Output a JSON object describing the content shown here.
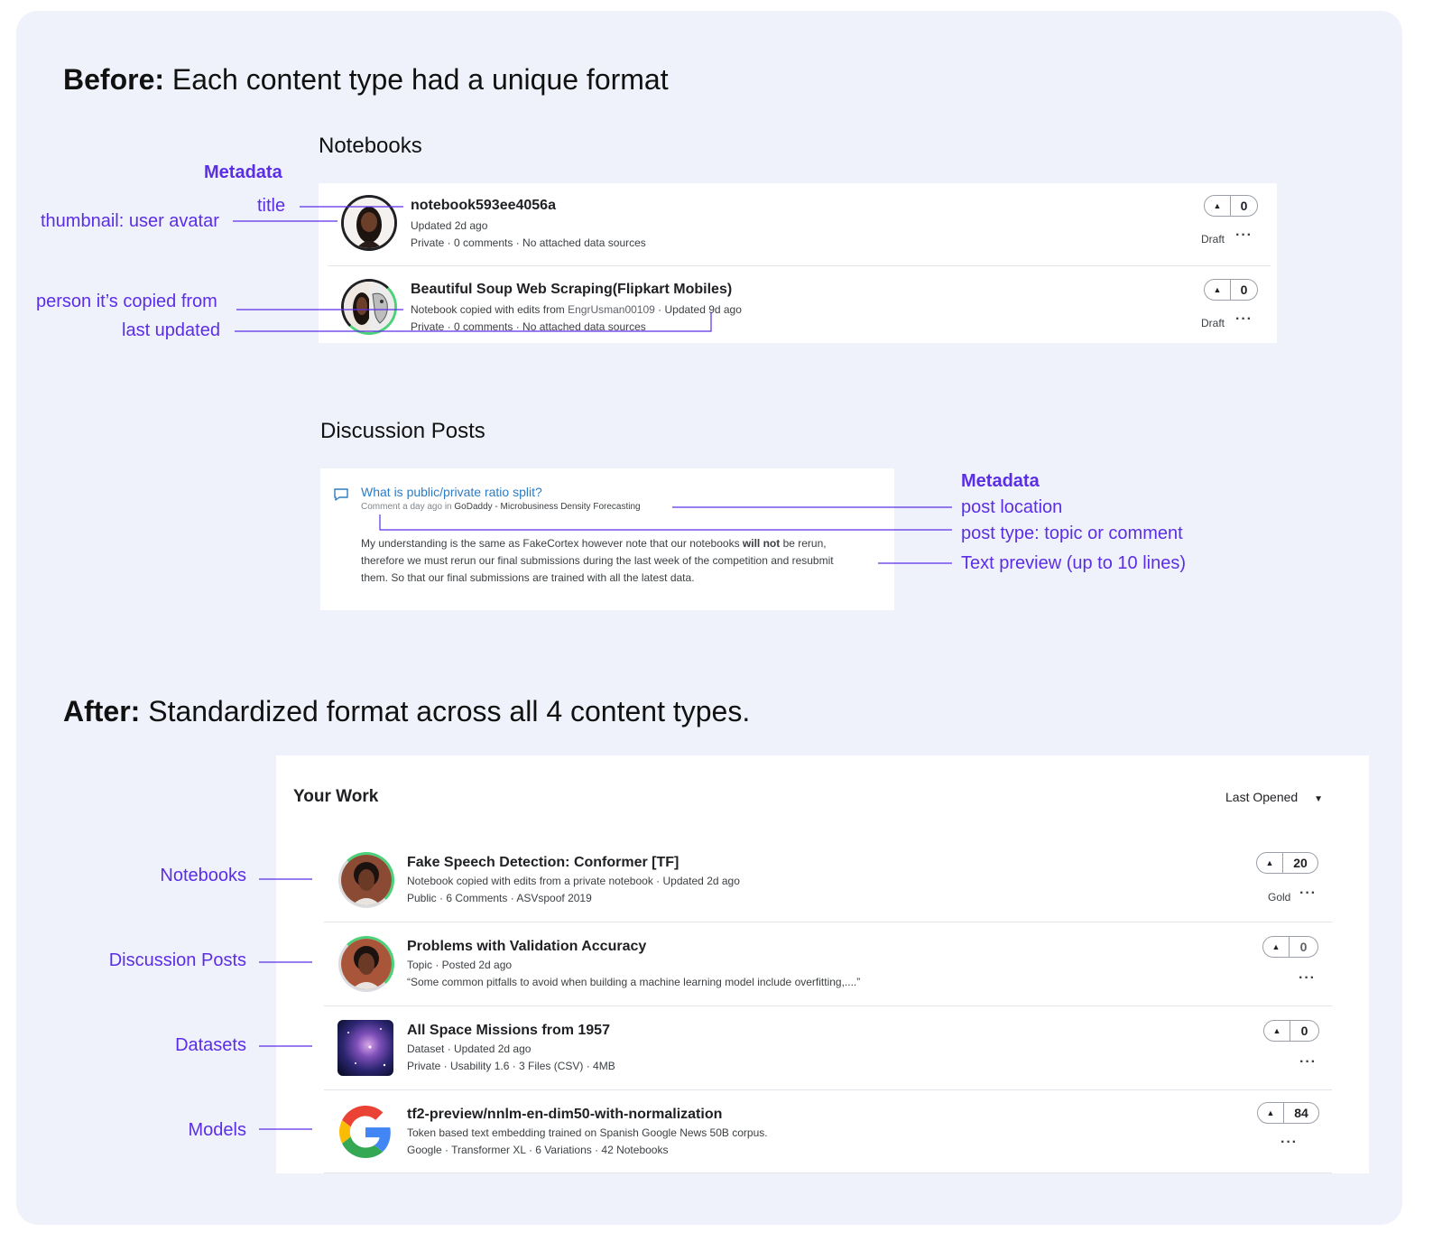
{
  "before": {
    "heading_bold": "Before:",
    "heading_rest": "Each content type had a unique format",
    "notebooks_title": "Notebooks",
    "annotations": {
      "metadata": "Metadata",
      "title": "title",
      "thumbnail": "thumbnail: user avatar",
      "copied_from": "person it’s copied from",
      "last_updated": "last updated"
    },
    "notebooks": [
      {
        "title": "notebook593ee4056a",
        "line1": "Updated 2d ago",
        "line2": "Private · 0 comments · No attached data sources",
        "votes": "0",
        "status": "Draft"
      },
      {
        "title": "Beautiful Soup Web Scraping(Flipkart Mobiles)",
        "line1_prefix": "Notebook copied with edits from ",
        "line1_user": "EngrUsman00109",
        "line1_suffix": " · Updated 9d ago",
        "line2": "Private · 0 comments · No attached data sources",
        "votes": "0",
        "status": "Draft"
      }
    ],
    "discussion_title": "Discussion Posts",
    "discussion": {
      "title": "What is public/private ratio split?",
      "meta_prefix": "Comment a day ago in ",
      "meta_location": "GoDaddy - Microbusiness Density Forecasting",
      "body_1": "My understanding is the same as FakeCortex however note that our notebooks ",
      "body_bold": "will not",
      "body_2": " be rerun,",
      "body_line2": "therefore we must rerun our final submissions during the last week of the competition and resubmit",
      "body_line3": "them. So that our final submissions are trained with all the latest data."
    },
    "discussion_annotations": {
      "metadata": "Metadata",
      "post_location": "post location",
      "post_type": "post type: topic or comment",
      "text_preview": "Text preview (up to 10 lines)"
    }
  },
  "after": {
    "heading_bold": "After:",
    "heading_rest": "Standardized format across all 4 content types.",
    "card_title": "Your Work",
    "sort_label": "Last Opened",
    "labels": [
      "Notebooks",
      "Discussion Posts",
      "Datasets",
      "Models"
    ],
    "items": [
      {
        "title": "Fake Speech Detection: Conformer [TF]",
        "line1": "Notebook copied with edits from a private notebook · Updated 2d ago",
        "line2": "Public · 6 Comments · ASVspoof 2019",
        "votes": "20",
        "medal": "Gold"
      },
      {
        "title": "Problems with Validation Accuracy",
        "line1": "Topic · Posted 2d ago",
        "line2": "“Some common pitfalls to avoid when building a machine learning model include overfitting,....”",
        "votes": "0"
      },
      {
        "title": "All Space Missions from 1957",
        "line1": "Dataset · Updated 2d ago",
        "line2": "Private · Usability 1.6 · 3 Files (CSV) · 4MB",
        "votes": "0"
      },
      {
        "title": "tf2-preview/nnlm-en-dim50-with-normalization",
        "line1": "Token based text embedding trained on Spanish Google News 50B corpus.",
        "line2": "Google · Transformer XL · 6 Variations · 42 Notebooks",
        "votes": "84"
      }
    ]
  },
  "colors": {
    "annotation": "#5b2ee6",
    "link": "#2d7bc4",
    "panel": "#eff2fa",
    "progress_green": "#4cd17a"
  }
}
